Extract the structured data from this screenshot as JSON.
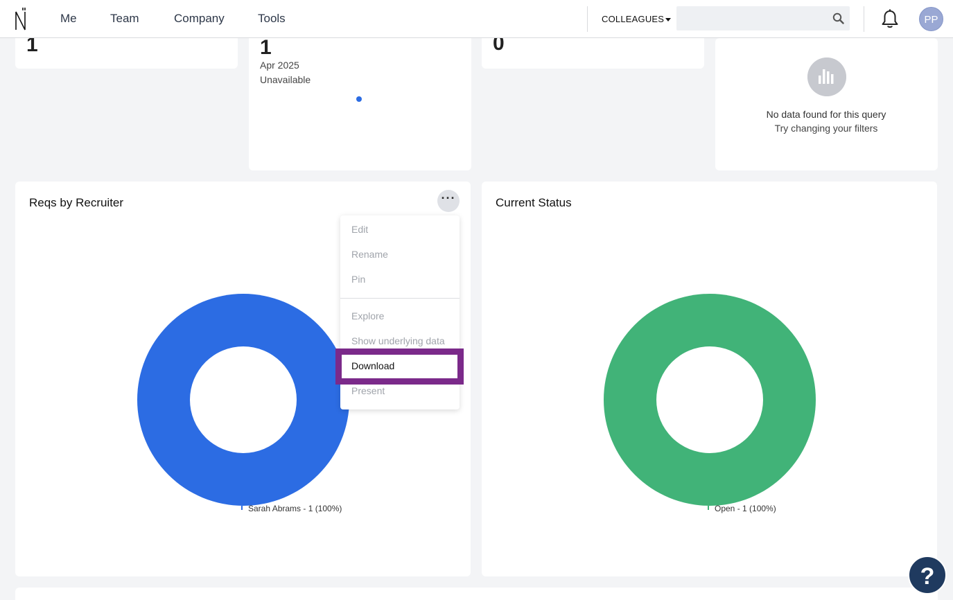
{
  "nav": {
    "items": [
      "Me",
      "Team",
      "Company",
      "Tools"
    ],
    "colleagues_label": "COLLEAGUES",
    "search_placeholder": "",
    "avatar_initials": "PP"
  },
  "cards": {
    "card1_value": "1",
    "card2_value": "1",
    "card2_date": "Apr 2025",
    "card2_status": "Unavailable",
    "card3_value": "0",
    "no_data_title": "No data found for this query",
    "no_data_sub": "Try changing your filters"
  },
  "reqs_chart": {
    "title": "Reqs by Recruiter",
    "legend": "Sarah Abrams - 1 (100%)",
    "color": "#2c6ce3"
  },
  "status_chart": {
    "title": "Current Status",
    "legend": "Open - 1 (100%)",
    "color": "#41b378"
  },
  "menu": {
    "edit": "Edit",
    "rename": "Rename",
    "pin": "Pin",
    "explore": "Explore",
    "show_data": "Show underlying data",
    "download": "Download",
    "present": "Present"
  },
  "help_label": "?"
}
